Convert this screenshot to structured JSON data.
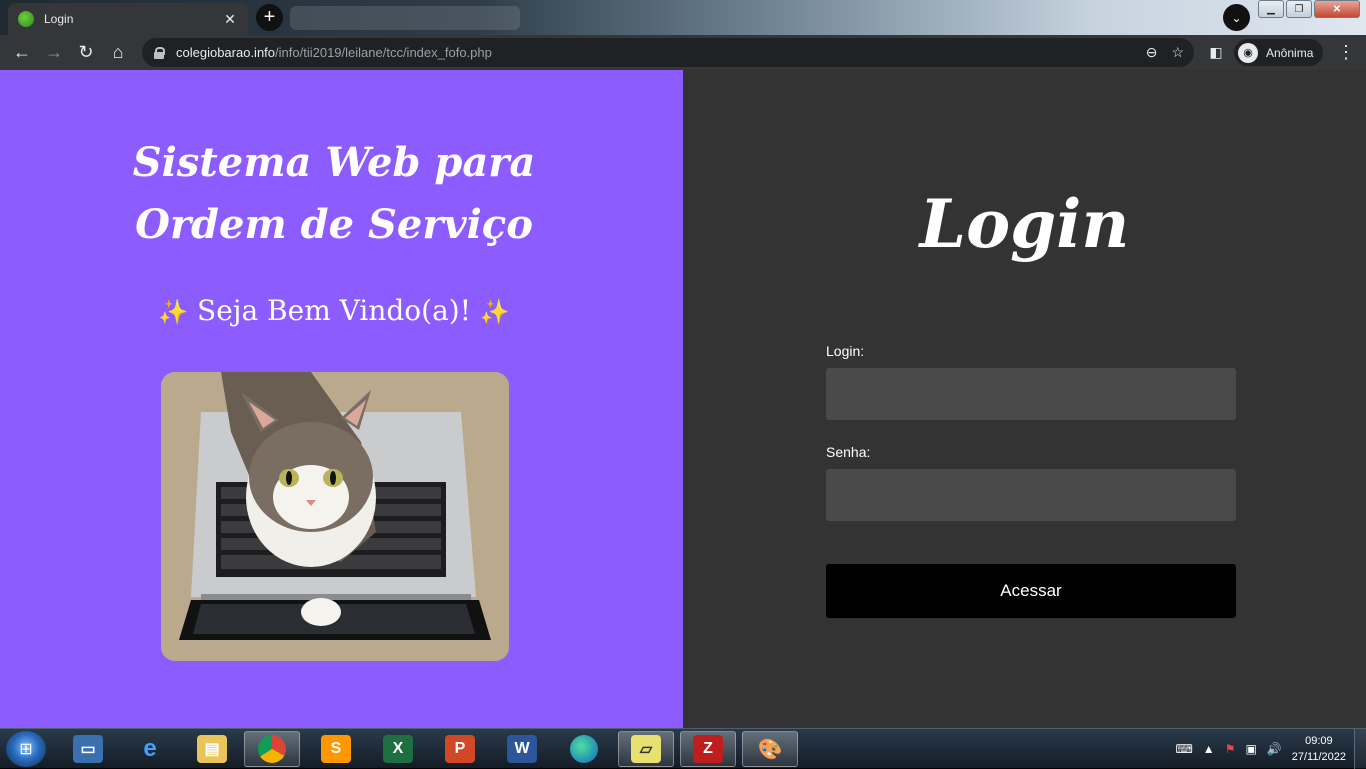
{
  "browser": {
    "tab_title": "Login",
    "new_tab_glyph": "+",
    "close_glyph": "✕",
    "url_host": "colegiobarao.info",
    "url_path": "/info/tii2019/leilane/tcc/index_fofo.php",
    "profile_label": "Anônima"
  },
  "hero": {
    "title_line1": "Sistema Web para",
    "title_line2": "Ordem de Serviço",
    "welcome": "Seja Bem Vindo(a)!"
  },
  "login": {
    "title": "Login",
    "login_label": "Login:",
    "login_value": "",
    "password_label": "Senha:",
    "password_value": "",
    "submit_label": "Acessar"
  },
  "taskbar": {
    "apps": [
      "windows-start",
      "show-desktop-app",
      "internet-explorer",
      "file-explorer",
      "chrome",
      "sublime-text",
      "excel",
      "powerpoint",
      "word",
      "edge",
      "sticky-notes",
      "filezilla",
      "paint"
    ],
    "time": "09:09",
    "date": "27/11/2022"
  },
  "colors": {
    "left_panel": "#8c5cff",
    "right_panel": "#333333",
    "input_bg": "#4a4a4a",
    "button_bg": "#000000"
  }
}
